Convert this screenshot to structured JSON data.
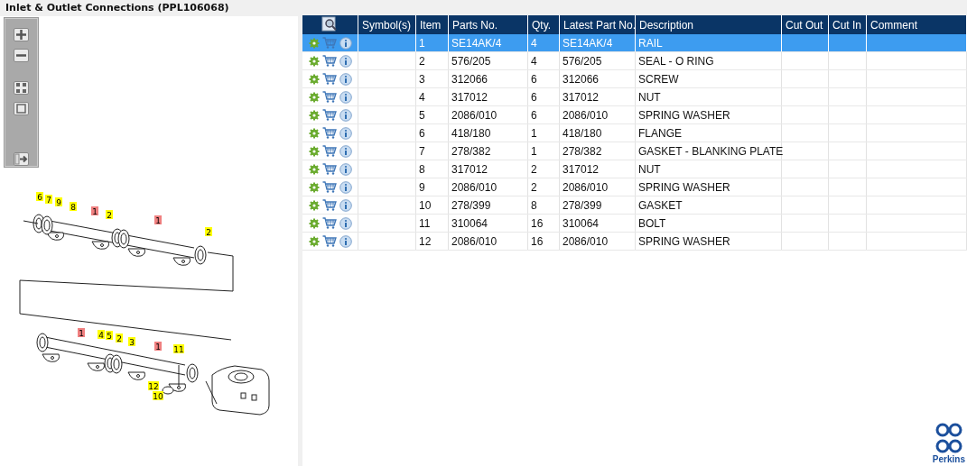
{
  "window": {
    "title": "Inlet & Outlet Connections (PPL106068)"
  },
  "diagram": {
    "callouts": [
      {
        "label": "6",
        "highlighted": false
      },
      {
        "label": "7",
        "highlighted": false
      },
      {
        "label": "9",
        "highlighted": false
      },
      {
        "label": "8",
        "highlighted": false
      },
      {
        "label": "1",
        "highlighted": true
      },
      {
        "label": "2",
        "highlighted": false
      },
      {
        "label": "1",
        "highlighted": true
      },
      {
        "label": "2",
        "highlighted": false
      },
      {
        "label": "1",
        "highlighted": true
      },
      {
        "label": "4",
        "highlighted": false
      },
      {
        "label": "5",
        "highlighted": false
      },
      {
        "label": "2",
        "highlighted": false
      },
      {
        "label": "3",
        "highlighted": false
      },
      {
        "label": "1",
        "highlighted": true
      },
      {
        "label": "11",
        "highlighted": false
      },
      {
        "label": "12",
        "highlighted": false
      },
      {
        "label": "10",
        "highlighted": false
      }
    ]
  },
  "table": {
    "columns": [
      "Symbol(s)",
      "Item",
      "Parts No.",
      "Qty.",
      "Latest Part No.",
      "Description",
      "Cut Out",
      "Cut In",
      "Comment"
    ],
    "rows": [
      {
        "selected": true,
        "cells": [
          "",
          "1",
          "SE14AK/4",
          "4",
          "SE14AK/4",
          "RAIL",
          "",
          "",
          ""
        ]
      },
      {
        "selected": false,
        "cells": [
          "",
          "2",
          "576/205",
          "4",
          "576/205",
          "SEAL - O RING",
          "",
          "",
          ""
        ]
      },
      {
        "selected": false,
        "cells": [
          "",
          "3",
          "312066",
          "6",
          "312066",
          "SCREW",
          "",
          "",
          ""
        ]
      },
      {
        "selected": false,
        "cells": [
          "",
          "4",
          "317012",
          "6",
          "317012",
          "NUT",
          "",
          "",
          ""
        ]
      },
      {
        "selected": false,
        "cells": [
          "",
          "5",
          "2086/010",
          "6",
          "2086/010",
          "SPRING WASHER",
          "",
          "",
          ""
        ]
      },
      {
        "selected": false,
        "cells": [
          "",
          "6",
          "418/180",
          "1",
          "418/180",
          "FLANGE",
          "",
          "",
          ""
        ]
      },
      {
        "selected": false,
        "cells": [
          "",
          "7",
          "278/382",
          "1",
          "278/382",
          "GASKET - BLANKING PLATE",
          "",
          "",
          ""
        ]
      },
      {
        "selected": false,
        "cells": [
          "",
          "8",
          "317012",
          "2",
          "317012",
          "NUT",
          "",
          "",
          ""
        ]
      },
      {
        "selected": false,
        "cells": [
          "",
          "9",
          "2086/010",
          "2",
          "2086/010",
          "SPRING WASHER",
          "",
          "",
          ""
        ]
      },
      {
        "selected": false,
        "cells": [
          "",
          "10",
          "278/399",
          "8",
          "278/399",
          "GASKET",
          "",
          "",
          ""
        ]
      },
      {
        "selected": false,
        "cells": [
          "",
          "11",
          "310064",
          "16",
          "310064",
          "BOLT",
          "",
          "",
          ""
        ]
      },
      {
        "selected": false,
        "cells": [
          "",
          "12",
          "2086/010",
          "16",
          "2086/010",
          "SPRING WASHER",
          "",
          "",
          ""
        ]
      }
    ]
  },
  "logo": {
    "text": "Perkins"
  }
}
